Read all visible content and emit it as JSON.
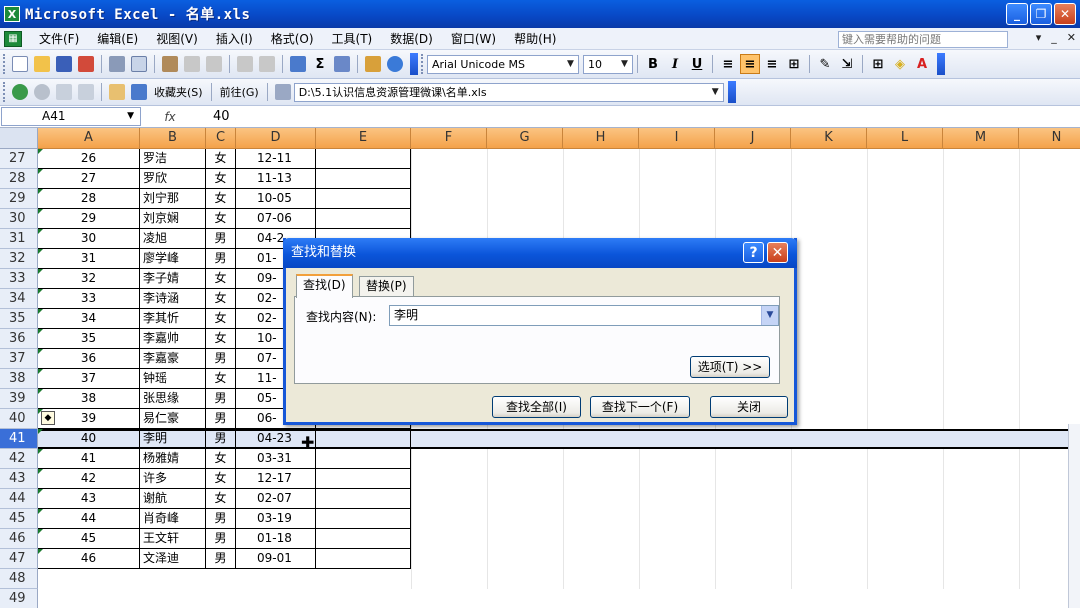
{
  "window": {
    "title": "Microsoft Excel - 名单.xls",
    "app_icon": "X",
    "controls": [
      "_",
      "❐",
      "✕"
    ]
  },
  "menu": {
    "items": [
      "文件(F)",
      "编辑(E)",
      "视图(V)",
      "插入(I)",
      "格式(O)",
      "工具(T)",
      "数据(D)",
      "窗口(W)",
      "帮助(H)"
    ],
    "help_placeholder": "键入需要帮助的问题",
    "right_controls": [
      "▾",
      "_",
      "✕"
    ]
  },
  "toolbar": {
    "font_name": "Arial Unicode MS",
    "font_size": "10",
    "bold": "B",
    "italic": "I",
    "underline": "U",
    "sigma": "Σ",
    "favorites": "收藏夹(S)",
    "goto": "前往(G)",
    "address": "D:\\5.1认识信息资源管理微课\\名单.xls"
  },
  "formula_bar": {
    "name_box": "A41",
    "fx": "fx",
    "value": "40"
  },
  "sheet": {
    "columns": [
      "A",
      "B",
      "C",
      "D",
      "E",
      "F",
      "G",
      "H",
      "I",
      "J",
      "K",
      "L",
      "M",
      "N"
    ],
    "rows": [
      {
        "n": "27",
        "a": "26",
        "b": "罗洁",
        "c": "女",
        "d": "12-11"
      },
      {
        "n": "28",
        "a": "27",
        "b": "罗欣",
        "c": "女",
        "d": "11-13"
      },
      {
        "n": "29",
        "a": "28",
        "b": "刘宁那",
        "c": "女",
        "d": "10-05"
      },
      {
        "n": "30",
        "a": "29",
        "b": "刘京娴",
        "c": "女",
        "d": "07-06"
      },
      {
        "n": "31",
        "a": "30",
        "b": "凌旭",
        "c": "男",
        "d": "04-2"
      },
      {
        "n": "32",
        "a": "31",
        "b": "廖学峰",
        "c": "男",
        "d": "01-"
      },
      {
        "n": "33",
        "a": "32",
        "b": "李子婧",
        "c": "女",
        "d": "09-"
      },
      {
        "n": "34",
        "a": "33",
        "b": "李诗涵",
        "c": "女",
        "d": "02-"
      },
      {
        "n": "35",
        "a": "34",
        "b": "李其忻",
        "c": "女",
        "d": "02-"
      },
      {
        "n": "36",
        "a": "35",
        "b": "李嘉帅",
        "c": "女",
        "d": "10-"
      },
      {
        "n": "37",
        "a": "36",
        "b": "李嘉豪",
        "c": "男",
        "d": "07-"
      },
      {
        "n": "38",
        "a": "37",
        "b": "钟瑶",
        "c": "女",
        "d": "11-"
      },
      {
        "n": "39",
        "a": "38",
        "b": "张思缘",
        "c": "男",
        "d": "05-"
      },
      {
        "n": "40",
        "a": "39",
        "b": "易仁豪",
        "c": "男",
        "d": "06-"
      },
      {
        "n": "41",
        "a": "40",
        "b": "李明",
        "c": "男",
        "d": "04-23"
      },
      {
        "n": "42",
        "a": "41",
        "b": "杨雅婧",
        "c": "女",
        "d": "03-31"
      },
      {
        "n": "43",
        "a": "42",
        "b": "许多",
        "c": "女",
        "d": "12-17"
      },
      {
        "n": "44",
        "a": "43",
        "b": "谢航",
        "c": "女",
        "d": "02-07"
      },
      {
        "n": "45",
        "a": "44",
        "b": "肖奇峰",
        "c": "男",
        "d": "03-19"
      },
      {
        "n": "46",
        "a": "45",
        "b": "王文轩",
        "c": "男",
        "d": "01-18"
      },
      {
        "n": "47",
        "a": "46",
        "b": "文泽迪",
        "c": "男",
        "d": "09-01"
      },
      {
        "n": "48",
        "a": "",
        "b": "",
        "c": "",
        "d": ""
      },
      {
        "n": "49",
        "a": "",
        "b": "",
        "c": "",
        "d": ""
      }
    ],
    "selected_row": "41"
  },
  "dialog": {
    "title": "查找和替换",
    "help": "?",
    "close": "✕",
    "tabs": [
      "查找(D)",
      "替换(P)"
    ],
    "find_label": "查找内容(N):",
    "find_value": "李明",
    "options_button": "选项(T) >>",
    "find_all_button": "查找全部(I)",
    "find_next_button": "查找下一个(F)",
    "close_button": "关闭"
  },
  "colors": {
    "title_bar": "#0847c4",
    "column_header": "#f4a24a",
    "active_tab_border": "#f2a03c"
  }
}
